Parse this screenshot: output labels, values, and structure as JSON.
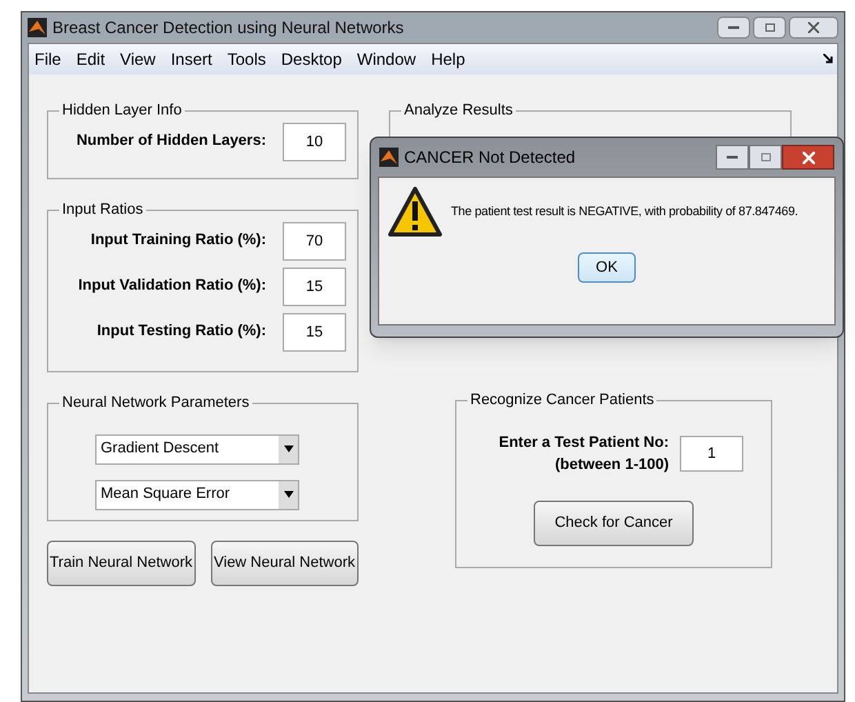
{
  "window": {
    "title": "Breast Cancer Detection using Neural Networks"
  },
  "menu": [
    "File",
    "Edit",
    "View",
    "Insert",
    "Tools",
    "Desktop",
    "Window",
    "Help"
  ],
  "hidden_layer_info": {
    "title": "Hidden Layer Info",
    "fields": [
      {
        "label": "Number of Hidden Layers:",
        "value": "10"
      }
    ]
  },
  "input_ratios": {
    "title": "Input Ratios",
    "fields": [
      {
        "label": "Input Training Ratio (%):",
        "value": "70"
      },
      {
        "label": "Input Validation Ratio (%):",
        "value": "15"
      },
      {
        "label": "Input Testing Ratio (%):",
        "value": "15"
      }
    ]
  },
  "neural_network_parameters": {
    "title": "Neural Network Parameters",
    "dropdowns": [
      "Gradient Descent",
      "Mean Square Error"
    ]
  },
  "buttons": [
    "Train Neural Network",
    "View Neural Network"
  ],
  "analyze_results": {
    "title": "Analyze Results"
  },
  "recognize": {
    "title": "Recognize Cancer Patients",
    "label_lines": [
      "Enter a Test Patient No:",
      "(between 1-100)"
    ],
    "value": "1",
    "button": "Check for Cancer"
  },
  "dialog": {
    "title": "CANCER Not Detected",
    "message": "The patient test result is NEGATIVE, with probability of 87.847469.",
    "button": "OK"
  }
}
